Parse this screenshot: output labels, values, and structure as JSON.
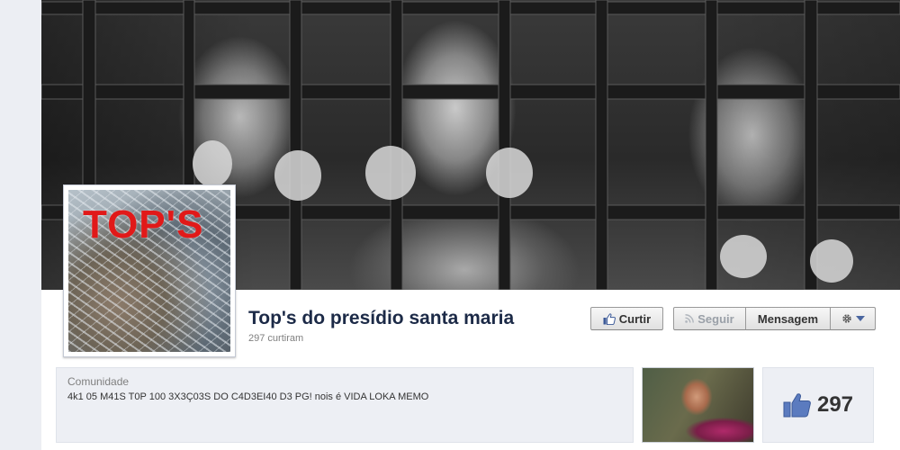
{
  "page": {
    "name": "Top's do presídio santa maria",
    "likes_line": "297 curtiram",
    "profile_pic_text": "TOP'S"
  },
  "actions": {
    "like_label": "Curtir",
    "follow_label": "Seguir",
    "message_label": "Mensagem"
  },
  "about": {
    "category": "Comunidade",
    "description": "4k1 05 M41S T0P 100 3X3Ç03S DO C4D3EI40 D3 PG! nois é VIDA LOKA MEMO"
  },
  "like_box": {
    "count": "297"
  },
  "colors": {
    "title": "#1c2a47",
    "pic_text": "#e11919",
    "panel_bg": "#edeff4"
  },
  "icons": {
    "like": "thumbs-up-icon",
    "follow": "rss-icon",
    "settings": "gear-icon",
    "dropdown": "chevron-down-icon"
  }
}
